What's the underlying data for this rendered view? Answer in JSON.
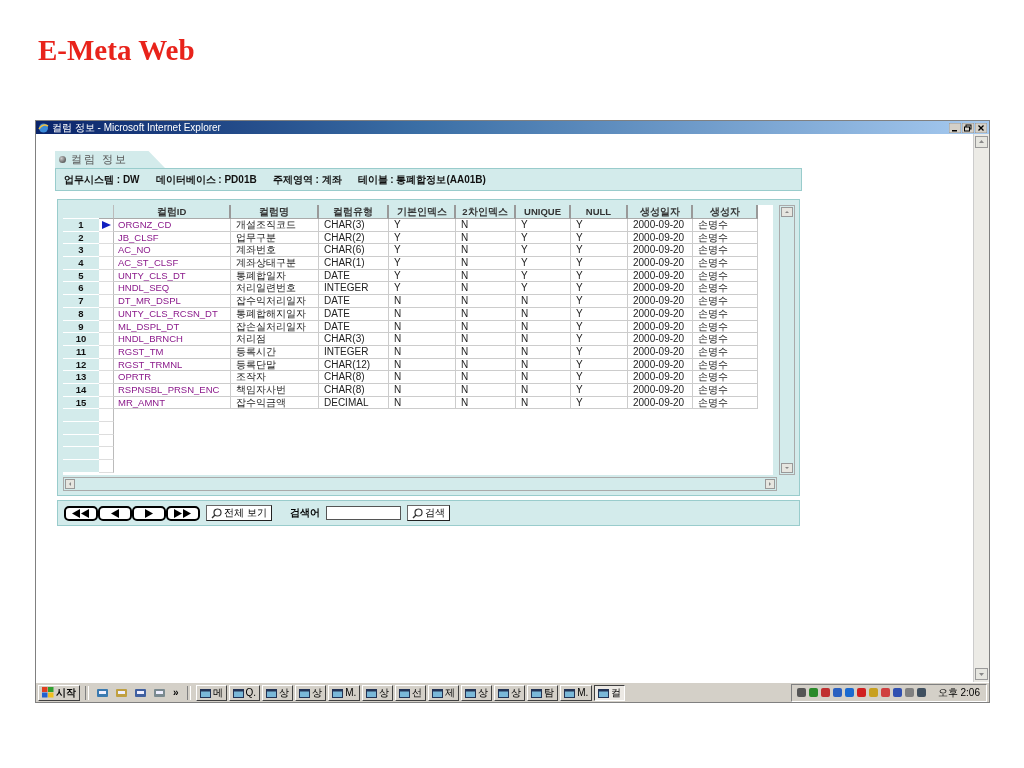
{
  "slide_title": "E-Meta Web",
  "window": {
    "title": "컬럼 정보 - Microsoft Internet Explorer"
  },
  "tab": {
    "label": "컬럼 정보"
  },
  "info": [
    {
      "label": "업무시스템 : DW"
    },
    {
      "label": "데이터베이스 : PD01B"
    },
    {
      "label": "주제영역 : 계좌"
    },
    {
      "label": "테이블 : 통폐합정보(AA01B)"
    }
  ],
  "table": {
    "columns": [
      "컬럼ID",
      "컬럼명",
      "컬럼유형",
      "기본인덱스",
      "2차인덱스",
      "UNIQUE",
      "NULL",
      "생성일자",
      "생성자"
    ],
    "rows": [
      {
        "number": "1",
        "selected": true,
        "cells": [
          "ORGNZ_CD",
          "개설조직코드",
          "CHAR(3)",
          "Y",
          "N",
          "Y",
          "Y",
          "2000-09-20",
          "손명수"
        ]
      },
      {
        "number": "2",
        "selected": false,
        "cells": [
          "JB_CLSF",
          "업무구분",
          "CHAR(2)",
          "Y",
          "N",
          "Y",
          "Y",
          "2000-09-20",
          "손명수"
        ]
      },
      {
        "number": "3",
        "selected": false,
        "cells": [
          "AC_NO",
          "계좌번호",
          "CHAR(6)",
          "Y",
          "N",
          "Y",
          "Y",
          "2000-09-20",
          "손명수"
        ]
      },
      {
        "number": "4",
        "selected": false,
        "cells": [
          "AC_ST_CLSF",
          "계좌상태구분",
          "CHAR(1)",
          "Y",
          "N",
          "Y",
          "Y",
          "2000-09-20",
          "손명수"
        ]
      },
      {
        "number": "5",
        "selected": false,
        "cells": [
          "UNTY_CLS_DT",
          "통폐합일자",
          "DATE",
          "Y",
          "N",
          "Y",
          "Y",
          "2000-09-20",
          "손명수"
        ]
      },
      {
        "number": "6",
        "selected": false,
        "cells": [
          "HNDL_SEQ",
          "처리일련번호",
          "INTEGER",
          "Y",
          "N",
          "Y",
          "Y",
          "2000-09-20",
          "손명수"
        ]
      },
      {
        "number": "7",
        "selected": false,
        "cells": [
          "DT_MR_DSPL",
          "잡수익처리일자",
          "DATE",
          "N",
          "N",
          "N",
          "Y",
          "2000-09-20",
          "손명수"
        ]
      },
      {
        "number": "8",
        "selected": false,
        "cells": [
          "UNTY_CLS_RCSN_DT",
          "통폐합해지일자",
          "DATE",
          "N",
          "N",
          "N",
          "Y",
          "2000-09-20",
          "손명수"
        ]
      },
      {
        "number": "9",
        "selected": false,
        "cells": [
          "ML_DSPL_DT",
          "잡손실처리일자",
          "DATE",
          "N",
          "N",
          "N",
          "Y",
          "2000-09-20",
          "손명수"
        ]
      },
      {
        "number": "10",
        "selected": false,
        "cells": [
          "HNDL_BRNCH",
          "처리점",
          "CHAR(3)",
          "N",
          "N",
          "N",
          "Y",
          "2000-09-20",
          "손명수"
        ]
      },
      {
        "number": "11",
        "selected": false,
        "cells": [
          "RGST_TM",
          "등록시간",
          "INTEGER",
          "N",
          "N",
          "N",
          "Y",
          "2000-09-20",
          "손명수"
        ]
      },
      {
        "number": "12",
        "selected": false,
        "cells": [
          "RGST_TRMNL",
          "등록단말",
          "CHAR(12)",
          "N",
          "N",
          "N",
          "Y",
          "2000-09-20",
          "손명수"
        ]
      },
      {
        "number": "13",
        "selected": false,
        "cells": [
          "OPRTR",
          "조작자",
          "CHAR(8)",
          "N",
          "N",
          "N",
          "Y",
          "2000-09-20",
          "손명수"
        ]
      },
      {
        "number": "14",
        "selected": false,
        "cells": [
          "RSPNSBL_PRSN_ENC",
          "책임자사번",
          "CHAR(8)",
          "N",
          "N",
          "N",
          "Y",
          "2000-09-20",
          "손명수"
        ]
      },
      {
        "number": "15",
        "selected": false,
        "cells": [
          "MR_AMNT",
          "잡수익금액",
          "DECIMAL",
          "N",
          "N",
          "N",
          "Y",
          "2000-09-20",
          "손명수"
        ]
      }
    ]
  },
  "pager": {
    "buttons": [
      {
        "kind": "first"
      },
      {
        "kind": "prev"
      },
      {
        "kind": "next"
      },
      {
        "kind": "last"
      }
    ],
    "show_all": "전체 보기",
    "search_label": "검색어",
    "search_button": "검색"
  },
  "taskbar": {
    "start": "시작",
    "more": "»",
    "tasks": [
      {
        "label": "메",
        "selected": false
      },
      {
        "label": "Q.",
        "selected": false
      },
      {
        "label": "상",
        "selected": false
      },
      {
        "label": "상",
        "selected": false
      },
      {
        "label": "M.",
        "selected": false
      },
      {
        "label": "상",
        "selected": false
      },
      {
        "label": "선",
        "selected": false
      },
      {
        "label": "제",
        "selected": false
      },
      {
        "label": "상",
        "selected": false
      },
      {
        "label": "상",
        "selected": false
      },
      {
        "label": "탐",
        "selected": false
      },
      {
        "label": "M.",
        "selected": false
      },
      {
        "label": "컬",
        "selected": true
      }
    ],
    "clock": "오후 2:06"
  }
}
